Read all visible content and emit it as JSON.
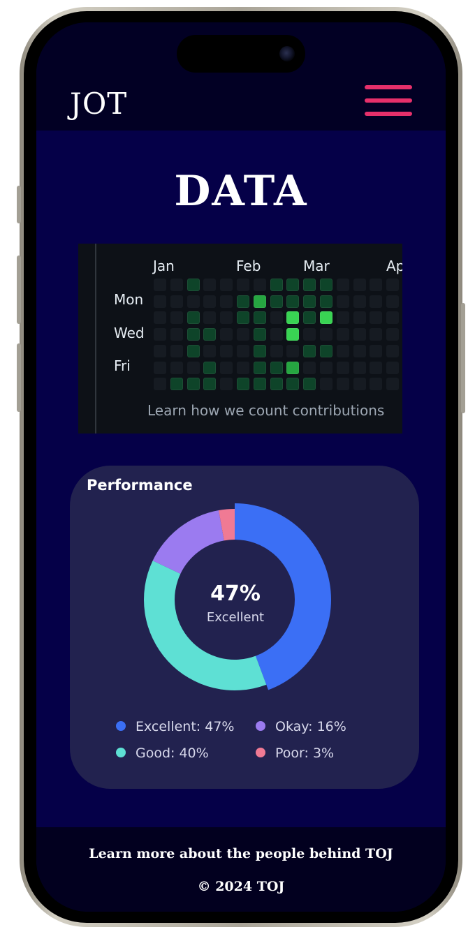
{
  "header": {
    "logo": "JOT",
    "menu_icon": "hamburger-icon",
    "menu_color": "#e6306b"
  },
  "main": {
    "title": "DATA",
    "contributions": {
      "months": [
        "Jan",
        "Feb",
        "Mar",
        "Ap"
      ],
      "day_labels": [
        "Mon",
        "Wed",
        "Fri"
      ],
      "link": "Learn how we count contributions",
      "colors": [
        "#161b22",
        "#0e4429",
        "#26a641",
        "#39d353"
      ],
      "levels": [
        [
          0,
          0,
          0,
          0,
          0,
          0,
          0
        ],
        [
          0,
          0,
          0,
          0,
          0,
          0,
          1
        ],
        [
          1,
          0,
          1,
          1,
          1,
          0,
          1
        ],
        [
          0,
          0,
          0,
          1,
          0,
          1,
          1
        ],
        [
          0,
          0,
          0,
          0,
          0,
          0,
          0
        ],
        [
          0,
          1,
          1,
          0,
          0,
          0,
          1
        ],
        [
          0,
          2,
          1,
          1,
          1,
          1,
          1
        ],
        [
          1,
          1,
          0,
          0,
          0,
          1,
          1
        ],
        [
          1,
          1,
          3,
          3,
          0,
          2,
          1
        ],
        [
          1,
          1,
          1,
          0,
          1,
          0,
          1
        ],
        [
          1,
          1,
          3,
          0,
          1,
          0,
          0
        ],
        [
          0,
          0,
          0,
          0,
          0,
          0,
          0
        ],
        [
          0,
          0,
          0,
          0,
          0,
          0,
          0
        ],
        [
          0,
          0,
          0,
          0,
          0,
          0,
          0
        ],
        [
          0,
          0,
          0,
          0,
          0,
          0,
          0
        ],
        [
          0,
          0,
          0,
          0,
          0,
          0,
          0
        ]
      ]
    },
    "performance": {
      "title": "Performance",
      "center_value": "47%",
      "center_label": "Excellent",
      "legend": [
        {
          "label": "Excellent: 47%",
          "color": "#3b6ff5"
        },
        {
          "label": "Okay: 16%",
          "color": "#9b7bf0"
        },
        {
          "label": "Good: 40%",
          "color": "#5ee0d4"
        },
        {
          "label": "Poor: 3%",
          "color": "#f07a94"
        }
      ]
    }
  },
  "chart_data": {
    "type": "pie",
    "title": "Performance",
    "categories": [
      "Excellent",
      "Good",
      "Okay",
      "Poor"
    ],
    "values": [
      47,
      40,
      16,
      3
    ],
    "colors": [
      "#3b6ff5",
      "#5ee0d4",
      "#9b7bf0",
      "#f07a94"
    ],
    "legend": "bottom"
  },
  "footer": {
    "link": "Learn more about the people behind TOJ",
    "copyright": "© 2024 TOJ"
  }
}
